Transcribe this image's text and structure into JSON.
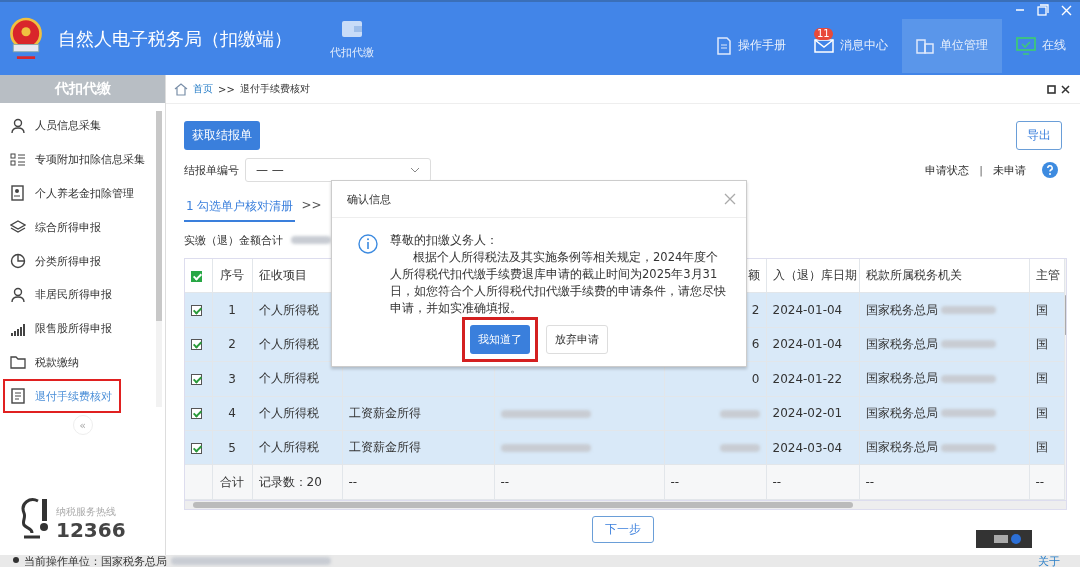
{
  "window": {
    "title": "自然人电子税务局（扣缴端）",
    "module_tab": {
      "label": "代扣代缴"
    }
  },
  "top_nav": [
    {
      "label": "操作手册",
      "kind": "manual",
      "selected": false
    },
    {
      "label": "消息中心",
      "kind": "message",
      "selected": false,
      "badge": "11"
    },
    {
      "label": "单位管理",
      "kind": "unit",
      "selected": true
    },
    {
      "label": "在线",
      "kind": "online",
      "selected": false
    }
  ],
  "sidebar": {
    "title": "代扣代缴",
    "items": [
      {
        "label": "人员信息采集",
        "kind": "person",
        "selected": false,
        "highlighted": false
      },
      {
        "label": "专项附加扣除信息采集",
        "kind": "list",
        "selected": false,
        "highlighted": false
      },
      {
        "label": "个人养老金扣除管理",
        "kind": "doc",
        "selected": false,
        "highlighted": false
      },
      {
        "label": "综合所得申报",
        "kind": "layers",
        "selected": false,
        "highlighted": false
      },
      {
        "label": "分类所得申报",
        "kind": "pie",
        "selected": false,
        "highlighted": false
      },
      {
        "label": "非居民所得申报",
        "kind": "person",
        "selected": false,
        "highlighted": false
      },
      {
        "label": "限售股所得申报",
        "kind": "bars",
        "selected": false,
        "highlighted": false
      },
      {
        "label": "税款缴纳",
        "kind": "folder",
        "selected": false,
        "highlighted": false
      },
      {
        "label": "退付手续费核对",
        "kind": "form",
        "selected": true,
        "highlighted": true
      }
    ],
    "collapse": "«",
    "hotline": {
      "label": "纳税服务热线",
      "number": "12366"
    }
  },
  "breadcrumb": [
    "首页",
    ">>",
    "退付手续费核对"
  ],
  "toolbar": {
    "fetch_button": "获取结报单",
    "export_button": "导出",
    "report_label": "结报单编号",
    "report_value": "— —",
    "status_label": "申请状态",
    "separator": "|",
    "status_value": "未申请"
  },
  "steps": [
    {
      "label": "1 勾选单户核对清册",
      "selected": true
    },
    {
      "label": ">>",
      "selected": false
    }
  ],
  "amount_label": "实缴（退）金额合计",
  "table": {
    "all_checked": true,
    "columns": [
      "序号",
      "征收项目",
      "",
      "",
      "额",
      "入（退）库日期",
      "税款所属税务机关",
      "主管"
    ],
    "rows": [
      {
        "checked": true,
        "cells": [
          "1",
          "个人所得税",
          "",
          "",
          "2",
          "2024-01-04",
          "国家税务总局",
          "国"
        ]
      },
      {
        "checked": true,
        "cells": [
          "2",
          "个人所得税",
          "",
          "",
          "6",
          "2024-01-04",
          "国家税务总局",
          "国"
        ]
      },
      {
        "checked": true,
        "cells": [
          "3",
          "个人所得税",
          "",
          "",
          "0",
          "2024-01-22",
          "国家税务总局",
          "国"
        ]
      },
      {
        "checked": true,
        "cells": [
          "4",
          "个人所得税",
          "工资薪金所得",
          "",
          "",
          "2024-02-01",
          "国家税务总局",
          "国"
        ]
      },
      {
        "checked": true,
        "cells": [
          "5",
          "个人所得税",
          "工资薪金所得",
          "",
          "",
          "2024-03-04",
          "国家税务总局",
          "国"
        ]
      }
    ],
    "footer": [
      "合计",
      "记录数：20",
      "--",
      "--",
      "--",
      "--",
      "--",
      "--"
    ]
  },
  "next_button": "下一步",
  "dialog": {
    "title": "确认信息",
    "greeting": "尊敬的扣缴义务人：",
    "body": "根据个人所得税法及其实施条例等相关规定，2024年度个人所得税代扣代缴手续费退库申请的截止时间为2025年3月31日，如您符合个人所得税代扣代缴手续费的申请条件，请您尽快申请，并如实准确填报。",
    "buttons": [
      {
        "label": "我知道了",
        "primary": true,
        "highlighted": true
      },
      {
        "label": "放弃申请",
        "primary": false,
        "highlighted": false
      }
    ]
  },
  "status_bar": {
    "unit_label": "当前操作单位：国家税务总局",
    "about": "关于"
  }
}
